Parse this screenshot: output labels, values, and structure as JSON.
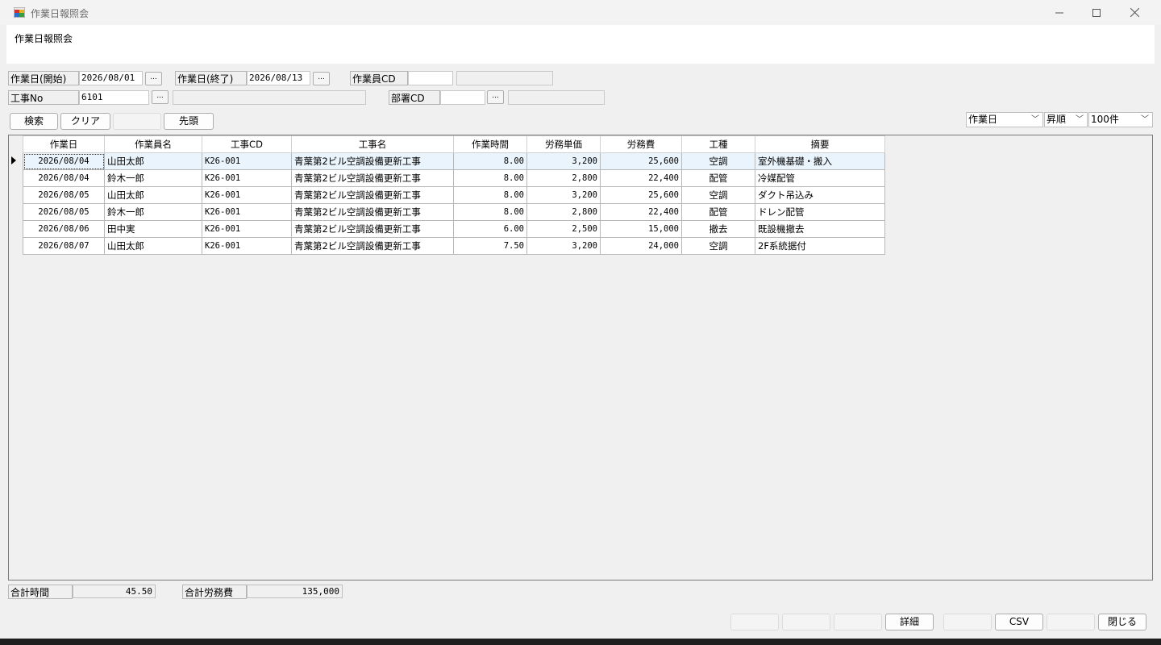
{
  "window": {
    "title": "作業日報照会"
  },
  "header": {
    "title": "作業日報照会"
  },
  "form": {
    "date_start_label": "作業日(開始)",
    "date_start_value": "2026/08/01",
    "date_end_label": "作業日(終了)",
    "date_end_value": "2026/08/13",
    "worker_cd_label": "作業員CD",
    "worker_cd_value": "",
    "koji_no_label": "工事No",
    "koji_no_value": "6101",
    "dept_cd_label": "部署CD",
    "dept_cd_value": "",
    "picker_label": "..."
  },
  "toolbar": {
    "search_label": "検索",
    "clear_label": "クリア",
    "top_label": "先頭",
    "sort_field": "作業日",
    "sort_order": "昇順",
    "page_size": "100件"
  },
  "grid": {
    "columns": [
      "作業日",
      "作業員名",
      "工事CD",
      "工事名",
      "作業時間",
      "労務単価",
      "労務費",
      "工種",
      "摘要"
    ],
    "rows": [
      {
        "date": "2026/08/04",
        "worker": "山田太郎",
        "koji_cd": "K26-001",
        "koji_name": "青葉第2ビル空調設備更新工事",
        "hours": "8.00",
        "unit_price": "3,200",
        "cost": "25,600",
        "type": "空調",
        "note": "室外機基礎・搬入"
      },
      {
        "date": "2026/08/04",
        "worker": "鈴木一郎",
        "koji_cd": "K26-001",
        "koji_name": "青葉第2ビル空調設備更新工事",
        "hours": "8.00",
        "unit_price": "2,800",
        "cost": "22,400",
        "type": "配管",
        "note": "冷媒配管"
      },
      {
        "date": "2026/08/05",
        "worker": "山田太郎",
        "koji_cd": "K26-001",
        "koji_name": "青葉第2ビル空調設備更新工事",
        "hours": "8.00",
        "unit_price": "3,200",
        "cost": "25,600",
        "type": "空調",
        "note": "ダクト吊込み"
      },
      {
        "date": "2026/08/05",
        "worker": "鈴木一郎",
        "koji_cd": "K26-001",
        "koji_name": "青葉第2ビル空調設備更新工事",
        "hours": "8.00",
        "unit_price": "2,800",
        "cost": "22,400",
        "type": "配管",
        "note": "ドレン配管"
      },
      {
        "date": "2026/08/06",
        "worker": "田中実",
        "koji_cd": "K26-001",
        "koji_name": "青葉第2ビル空調設備更新工事",
        "hours": "6.00",
        "unit_price": "2,500",
        "cost": "15,000",
        "type": "撤去",
        "note": "既設機撤去"
      },
      {
        "date": "2026/08/07",
        "worker": "山田太郎",
        "koji_cd": "K26-001",
        "koji_name": "青葉第2ビル空調設備更新工事",
        "hours": "7.50",
        "unit_price": "3,200",
        "cost": "24,000",
        "type": "空調",
        "note": "2F系統据付"
      }
    ]
  },
  "totals": {
    "hours_label": "合計時間",
    "hours_value": "45.50",
    "cost_label": "合計労務費",
    "cost_value": "135,000"
  },
  "footer": {
    "detail_label": "詳細",
    "csv_label": "CSV",
    "close_label": "閉じる"
  }
}
